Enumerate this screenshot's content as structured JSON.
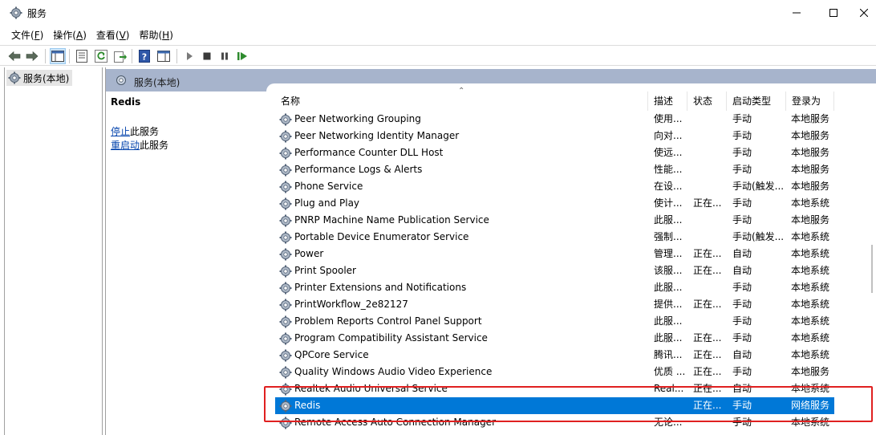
{
  "window": {
    "title": "服务"
  },
  "menu": [
    {
      "label": "文件(",
      "key": "F",
      "end": ")"
    },
    {
      "label": "操作(",
      "key": "A",
      "end": ")"
    },
    {
      "label": "查看(",
      "key": "V",
      "end": ")"
    },
    {
      "label": "帮助(",
      "key": "H",
      "end": ")"
    }
  ],
  "tree": {
    "item_label": "服务(本地)"
  },
  "panel": {
    "header_title": "服务(本地)",
    "selected_name": "Redis",
    "stop_link": "停止",
    "stop_suffix": "此服务",
    "restart_link": "重启动",
    "restart_suffix": "此服务"
  },
  "grid": {
    "columns": [
      "名称",
      "描述",
      "状态",
      "启动类型",
      "登录为"
    ],
    "rows": [
      {
        "name": "Peer Networking Grouping",
        "desc": "使用...",
        "status": "",
        "start": "手动",
        "logon": "本地服务"
      },
      {
        "name": "Peer Networking Identity Manager",
        "desc": "向对...",
        "status": "",
        "start": "手动",
        "logon": "本地服务"
      },
      {
        "name": "Performance Counter DLL Host",
        "desc": "使远...",
        "status": "",
        "start": "手动",
        "logon": "本地服务"
      },
      {
        "name": "Performance Logs & Alerts",
        "desc": "性能...",
        "status": "",
        "start": "手动",
        "logon": "本地服务"
      },
      {
        "name": "Phone Service",
        "desc": "在设...",
        "status": "",
        "start": "手动(触发...",
        "logon": "本地服务"
      },
      {
        "name": "Plug and Play",
        "desc": "使计...",
        "status": "正在...",
        "start": "手动",
        "logon": "本地系统"
      },
      {
        "name": "PNRP Machine Name Publication Service",
        "desc": "此服...",
        "status": "",
        "start": "手动",
        "logon": "本地服务"
      },
      {
        "name": "Portable Device Enumerator Service",
        "desc": "强制...",
        "status": "",
        "start": "手动(触发...",
        "logon": "本地系统"
      },
      {
        "name": "Power",
        "desc": "管理...",
        "status": "正在...",
        "start": "自动",
        "logon": "本地系统"
      },
      {
        "name": "Print Spooler",
        "desc": "该服...",
        "status": "正在...",
        "start": "自动",
        "logon": "本地系统"
      },
      {
        "name": "Printer Extensions and Notifications",
        "desc": "此服...",
        "status": "",
        "start": "手动",
        "logon": "本地系统"
      },
      {
        "name": "PrintWorkflow_2e82127",
        "desc": "提供...",
        "status": "正在...",
        "start": "手动",
        "logon": "本地系统"
      },
      {
        "name": "Problem Reports Control Panel Support",
        "desc": "此服...",
        "status": "",
        "start": "手动",
        "logon": "本地系统"
      },
      {
        "name": "Program Compatibility Assistant Service",
        "desc": "此服...",
        "status": "正在...",
        "start": "手动",
        "logon": "本地系统"
      },
      {
        "name": "QPCore Service",
        "desc": "腾讯...",
        "status": "正在...",
        "start": "自动",
        "logon": "本地系统"
      },
      {
        "name": "Quality Windows Audio Video Experience",
        "desc": "优质 ...",
        "status": "正在...",
        "start": "手动",
        "logon": "本地服务"
      },
      {
        "name": "Realtek Audio Universal Service",
        "desc": "Real...",
        "status": "正在...",
        "start": "自动",
        "logon": "本地系统"
      },
      {
        "name": "Redis",
        "desc": "",
        "status": "正在...",
        "start": "手动",
        "logon": "网络服务",
        "selected": true
      },
      {
        "name": "Remote Access Auto Connection Manager",
        "desc": "无论...",
        "status": "",
        "start": "手动",
        "logon": "本地系统"
      }
    ]
  },
  "colors": {
    "selection": "#0078d7",
    "header_band": "#a7b4cc",
    "highlight": "#e02020"
  }
}
